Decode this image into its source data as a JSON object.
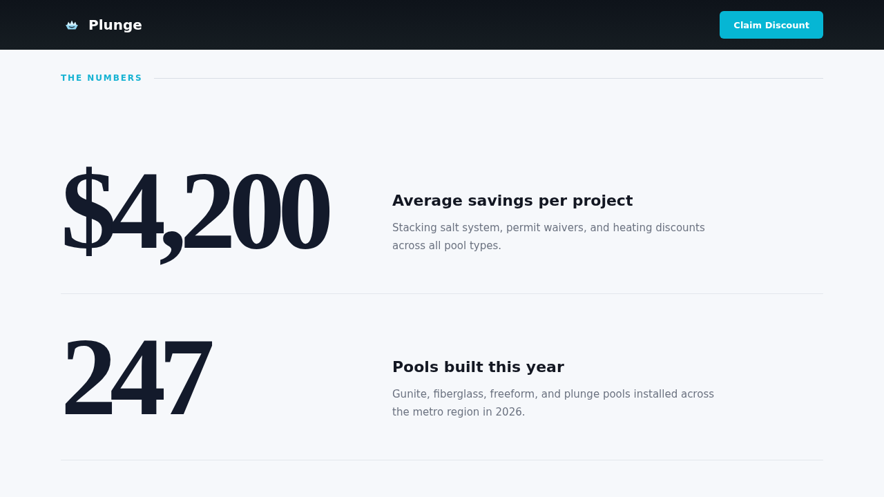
{
  "header": {
    "brand": "Plunge",
    "cta": "Claim Discount"
  },
  "section": {
    "label": "THE NUMBERS"
  },
  "stats": [
    {
      "value": "$4,200",
      "title": "Average savings per project",
      "description": "Stacking salt system, permit waivers, and heating discounts across all pool types."
    },
    {
      "value": "247",
      "title": "Pools built this year",
      "description": "Gunite, fiberglass, freeform, and plunge pools installed across the metro region in 2026."
    }
  ]
}
